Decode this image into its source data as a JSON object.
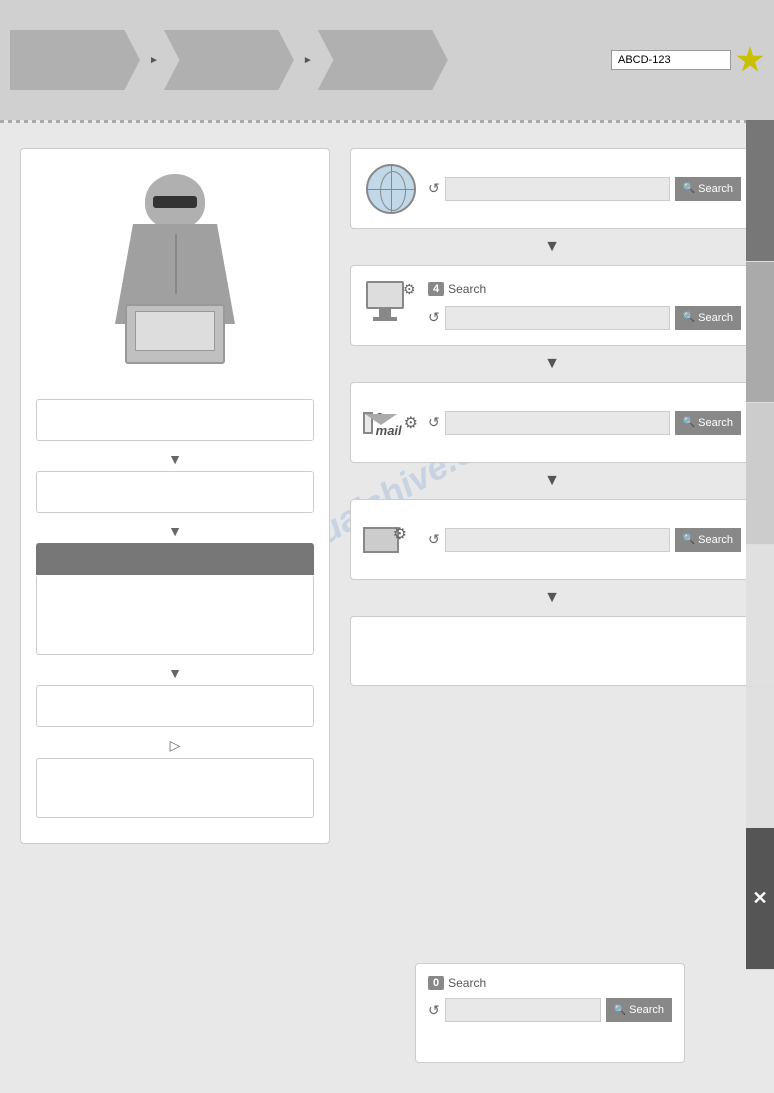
{
  "nav": {
    "steps": [
      {
        "label": "",
        "active": false,
        "first": true
      },
      {
        "label": "",
        "active": false,
        "first": false
      },
      {
        "label": "",
        "active": false,
        "first": false
      }
    ],
    "search_placeholder": "ABCD-123",
    "small_arrow1": "►",
    "small_arrow2": "►"
  },
  "left_panel": {
    "fields": [
      {
        "placeholder": ""
      },
      {
        "placeholder": ""
      },
      {
        "placeholder": ""
      },
      {
        "placeholder": ""
      },
      {
        "placeholder": ""
      }
    ],
    "textarea1": "",
    "textarea2": ""
  },
  "right_panel": {
    "cards": [
      {
        "icon": "globe",
        "count": "",
        "search_label": "Search",
        "input_value": "",
        "refresh": "↺"
      },
      {
        "icon": "computer",
        "count": "4",
        "search_label": "Search",
        "input_value": "",
        "refresh": "↺"
      },
      {
        "icon": "email",
        "count": "",
        "search_label": "Search",
        "input_value": "",
        "refresh": "↺"
      },
      {
        "icon": "envelope",
        "count": "",
        "search_label": "Search",
        "input_value": "",
        "refresh": "↺"
      },
      {
        "icon": "empty",
        "count": "",
        "search_label": "",
        "input_value": "",
        "refresh": ""
      }
    ]
  },
  "bottom_card": {
    "count": "0",
    "search_label": "Search",
    "input_value": "",
    "refresh": "↺"
  },
  "watermark": "manualshive.com",
  "sidebar": {
    "x_label": "✕"
  }
}
